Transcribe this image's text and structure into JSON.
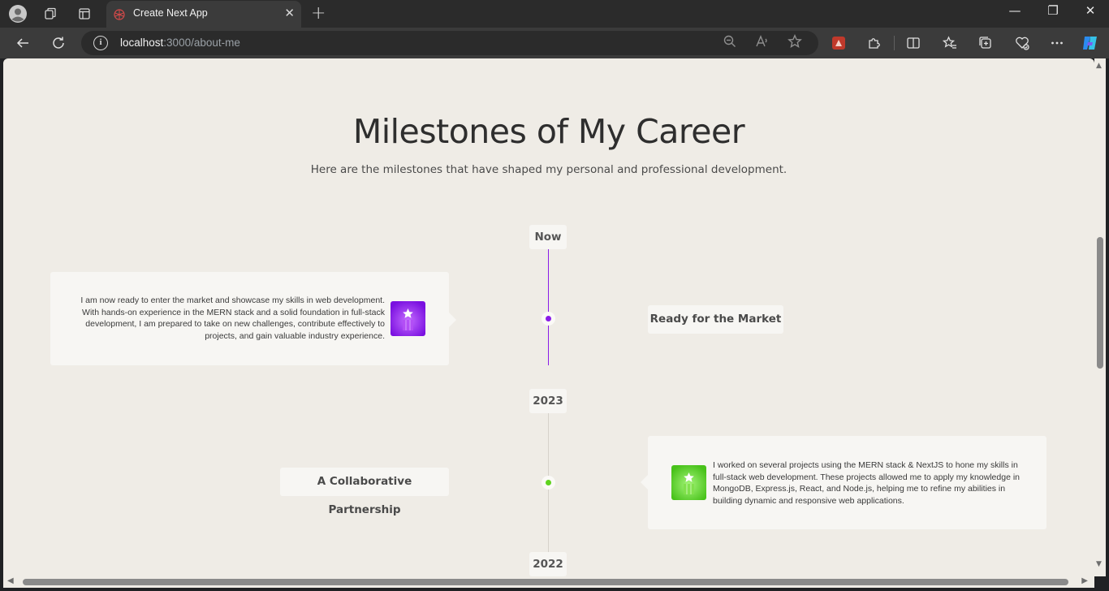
{
  "browser": {
    "tab_title": "Create Next App",
    "url_host": "localhost",
    "url_path": ":3000/about-me"
  },
  "page": {
    "title": "Milestones of My Career",
    "subtitle": "Here are the milestones that have shaped my personal and professional development."
  },
  "timeline": {
    "markers": [
      "Now",
      "2023",
      "2022"
    ],
    "items": [
      {
        "title": "Ready for the Market",
        "description": "I am now ready to enter the market and showcase my skills in web development. With hands-on experience in the MERN stack and a solid foundation in full-stack development, I am prepared to take on new challenges, contribute effectively to projects, and gain valuable industry experience.",
        "color": "#8a1ce8",
        "icon": "star-badge-icon"
      },
      {
        "title": "A Collaborative Partnership",
        "description": "I worked on several projects using the MERN stack & NextJS to hone my skills in full-stack web development. These projects allowed me to apply my knowledge in MongoDB, Express.js, React, and Node.js, helping me to refine my abilities in building dynamic and responsive web applications.",
        "color": "#5fd31f",
        "icon": "star-badge-icon"
      }
    ]
  }
}
